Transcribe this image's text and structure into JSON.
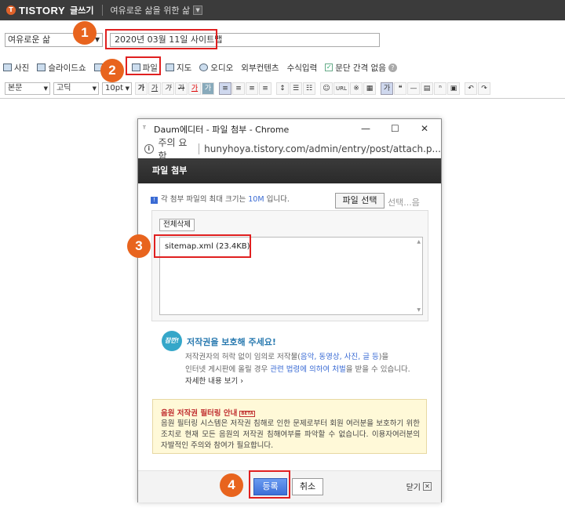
{
  "topbar": {
    "logo_mark": "T",
    "logo": "TISTORY",
    "logo_sub": "글쓰기",
    "blog_name": "여유로운 삶을 위한 삶"
  },
  "post": {
    "category": "여유로운 삶",
    "title": "2020년 03월 11일 사이트맵"
  },
  "toolbar1": {
    "items": [
      "사진",
      "슬라이드쇼",
      "파일",
      "지도",
      "오디오",
      "외부컨텐츠",
      "수식입력"
    ],
    "paragraph_gap": "문단 간격 없음"
  },
  "toolbar2": {
    "style_select": "본문",
    "font_select": "고딕",
    "size_select": "10pt",
    "buttons": [
      "가",
      "가",
      "가",
      "가",
      "가",
      "가",
      "URL",
      "※"
    ]
  },
  "markers": [
    "1",
    "2",
    "3",
    "4"
  ],
  "popup": {
    "window_title": "Daum에디터 - 파일 첨부 - Chrome",
    "security": "주의 요함",
    "url": "hunyhoya.tistory.com/admin/entry/post/attach.p...",
    "header": "파일 첨부",
    "limit_prefix": "각 첨부 파일의 최대 크기는",
    "limit_size": "10M",
    "limit_suffix": "입니다.",
    "file_select": "파일 선택",
    "file_status": "선택...음",
    "delete_all": "전체삭제",
    "file_item": "sitemap.xml (23.4KB)",
    "copyright": {
      "badge": "잠깐!",
      "heading": "저작권을 보호해 주세요!",
      "line1_a": "저작권자의 허락 없이 임의로 저작물(",
      "line1_b": "음악, 동영상, 사진, 글 등",
      "line1_c": ")을",
      "line2_a": "인터넷 게시판에 올릴 경우 ",
      "line2_b": "관련 법령에 의하여 처벌",
      "line2_c": "을 받을 수 있습니다.",
      "more": "자세한 내용 보기 ›"
    },
    "music": {
      "heading": "음원 저작권 필터링 안내",
      "beta": "BETA",
      "text": "음원 필터링 시스템은 저작권 침해로 인한 문제로부터 회원 여러분을 보호하기 위한 조치로 현재 모든 음원의 저작권 침해여부를 파악할 수 없습니다. 이용자여러분의 자발적인 주의와 참여가 필요합니다."
    },
    "register": "등록",
    "cancel": "취소",
    "close": "닫기"
  }
}
